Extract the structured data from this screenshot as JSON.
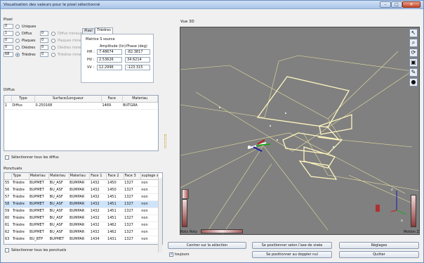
{
  "window": {
    "title": "Visualisation des valeurs pour le pixel sélectionné",
    "min": "–",
    "max": "□",
    "close": "✕"
  },
  "pixel": {
    "section": "Pixel",
    "rows": [
      {
        "count": "0",
        "label": "Uniques",
        "value": "",
        "min_label": "",
        "selected": false
      },
      {
        "count": "1",
        "label": "Diffus",
        "value": "0",
        "min_label": "Diffus mineurs",
        "selected": false
      },
      {
        "count": "0",
        "label": "Plaques",
        "value": "0",
        "min_label": "Plaques mineurs",
        "selected": false
      },
      {
        "count": "0",
        "label": "Dièdres",
        "value": "0",
        "min_label": "Dièdres mineurs",
        "selected": false
      },
      {
        "count": "68",
        "label": "Trièdres",
        "value": "0",
        "min_label": "Trièdres mineurs",
        "selected": true
      }
    ],
    "tabs": [
      "Pixel",
      "Trièdres"
    ],
    "matrix": {
      "title": "Matrice S source",
      "col_amp": "Amplitude (lin)",
      "col_phase": "Phase (deg)",
      "rows": [
        {
          "label": "HH :",
          "amp": "7.48674",
          "phase": "-82.3817"
        },
        {
          "label": "HV :",
          "amp": "2.53626",
          "phase": "34.6214"
        },
        {
          "label": "VV :",
          "amp": "12.2996",
          "phase": "-123.315"
        }
      ]
    }
  },
  "diffus": {
    "section": "Diffus",
    "columns": [
      "",
      "Type",
      "Surface/Longueur",
      "Face",
      "Materiau"
    ],
    "rows": [
      [
        "1",
        "Diffus",
        "0.250168",
        "1469",
        "BUTGRA"
      ]
    ],
    "select_all": "Sélectionner tous les diffus"
  },
  "ponctuels": {
    "section": "Ponctuels",
    "columns": [
      "",
      "Type",
      "Materiau",
      "Materiau",
      "Materiau",
      "Face 1",
      "Face 2",
      "Face 3",
      "suplage s"
    ],
    "rows": [
      [
        "55",
        "Trièdre",
        "BUPMET",
        "BU_ASF",
        "BUMPAR",
        "1432",
        "1450",
        "1327",
        "non"
      ],
      [
        "56",
        "Trièdre",
        "BUPMET",
        "BU_ASF",
        "BUMPAR",
        "1432",
        "1450",
        "1327",
        "non"
      ],
      [
        "57",
        "Trièdre",
        "BUPMET",
        "BU_ASF",
        "BUMPAR",
        "1432",
        "1451",
        "1327",
        "non"
      ],
      [
        "58",
        "Trièdre",
        "BUPMET",
        "BU_ASF",
        "BUMPAR",
        "1432",
        "1451",
        "1327",
        "non"
      ],
      [
        "59",
        "Trièdre",
        "BUPMET",
        "BU_ASF",
        "BUMPAR",
        "1432",
        "1451",
        "1327",
        "non"
      ],
      [
        "60",
        "Trièdre",
        "BUPMET",
        "BU_ASF",
        "BUMPAR",
        "1432",
        "1451",
        "1327",
        "non"
      ],
      [
        "61",
        "Trièdre",
        "BUPMET",
        "BU_ASF",
        "BUMPAR",
        "1432",
        "1462",
        "1327",
        "non"
      ],
      [
        "62",
        "Trièdre",
        "BUPMET",
        "BU_ASF",
        "BUMPAR",
        "1432",
        "1462",
        "1327",
        "non"
      ],
      [
        "63",
        "Trièdre",
        "BU_BTP",
        "BUPMET",
        "BUMPAR",
        "1434",
        "1431",
        "1327",
        "non"
      ]
    ],
    "selected_row": 3,
    "select_all": "Sélectionner tous les ponctuels"
  },
  "view3d": {
    "title": "Vue 3D",
    "rotx_label": "Rotx",
    "roty_label": "Roty",
    "motion_label": "Motion Z",
    "axis_z": "z",
    "axis_x": "x"
  },
  "toolbar_icons": [
    "select-arrow-icon",
    "zoom-icon",
    "rotate-icon",
    "display-icon",
    "measure-icon",
    "color-icon"
  ],
  "buttons": {
    "centrer": "Centrer sur la sélection",
    "visee": "Se positionner selon l'axe de visée",
    "reglages": "Réglages",
    "doppler": "Se positionner au doppler nul",
    "quitter": "Quitter",
    "toujours": "toujours"
  },
  "colors": {
    "wire": "#e8e0a0",
    "wire_hl": "#fff6c0",
    "view_bg": "#808080",
    "selection": "#cfe4fb"
  }
}
